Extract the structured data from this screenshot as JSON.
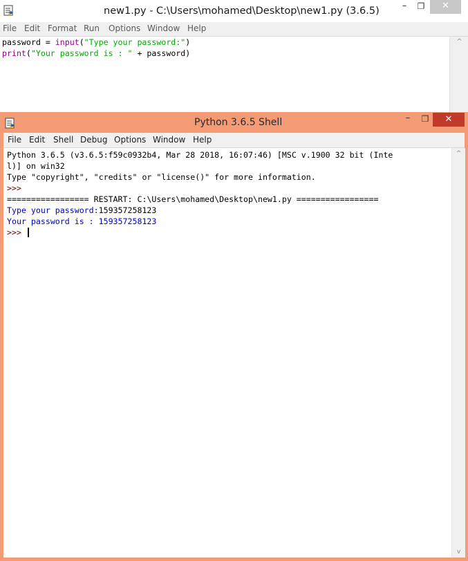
{
  "editor": {
    "title": "new1.py - C:\\Users\\mohamed\\Desktop\\new1.py (3.6.5)",
    "window_buttons": {
      "minimize": "–",
      "maximize": "❐",
      "close": "✕"
    },
    "menu": [
      "File",
      "Edit",
      "Format",
      "Run",
      "Options",
      "Window",
      "Help"
    ],
    "code": {
      "line1": {
        "var": "password = ",
        "func": "input",
        "open": "(",
        "str": "\"Type your password:\"",
        "close": ")"
      },
      "line2": {
        "func": "print",
        "open": "(",
        "str": "\"Your password is : \"",
        "rest": " + password)"
      }
    },
    "scroll_up": "^"
  },
  "shell": {
    "title": "Python 3.6.5 Shell",
    "window_buttons": {
      "minimize": "–",
      "maximize": "❐",
      "close": "✕"
    },
    "menu": [
      "File",
      "Edit",
      "Shell",
      "Debug",
      "Options",
      "Window",
      "Help"
    ],
    "lines": {
      "banner1": "Python 3.6.5 (v3.6.5:f59c0932b4, Mar 28 2018, 16:07:46) [MSC v.1900 32 bit (Inte",
      "banner2": "l)] on win32",
      "banner3": "Type \"copyright\", \"credits\" or \"license()\" for more information.",
      "prompt1": ">>>",
      "restart": "================= RESTART: C:\\Users\\mohamed\\Desktop\\new1.py =================",
      "input_prompt": "Type your password:",
      "input_value": "159357258123",
      "output": "Your password is : 159357258123",
      "prompt2": ">>> "
    },
    "scroll_up": "^",
    "scroll_down": "v"
  },
  "colors": {
    "shell_titlebar": "#f39b74",
    "close_button": "#c0392b",
    "stdout": "#0000c0",
    "builtin": "#900090",
    "string": "#00aa00"
  }
}
